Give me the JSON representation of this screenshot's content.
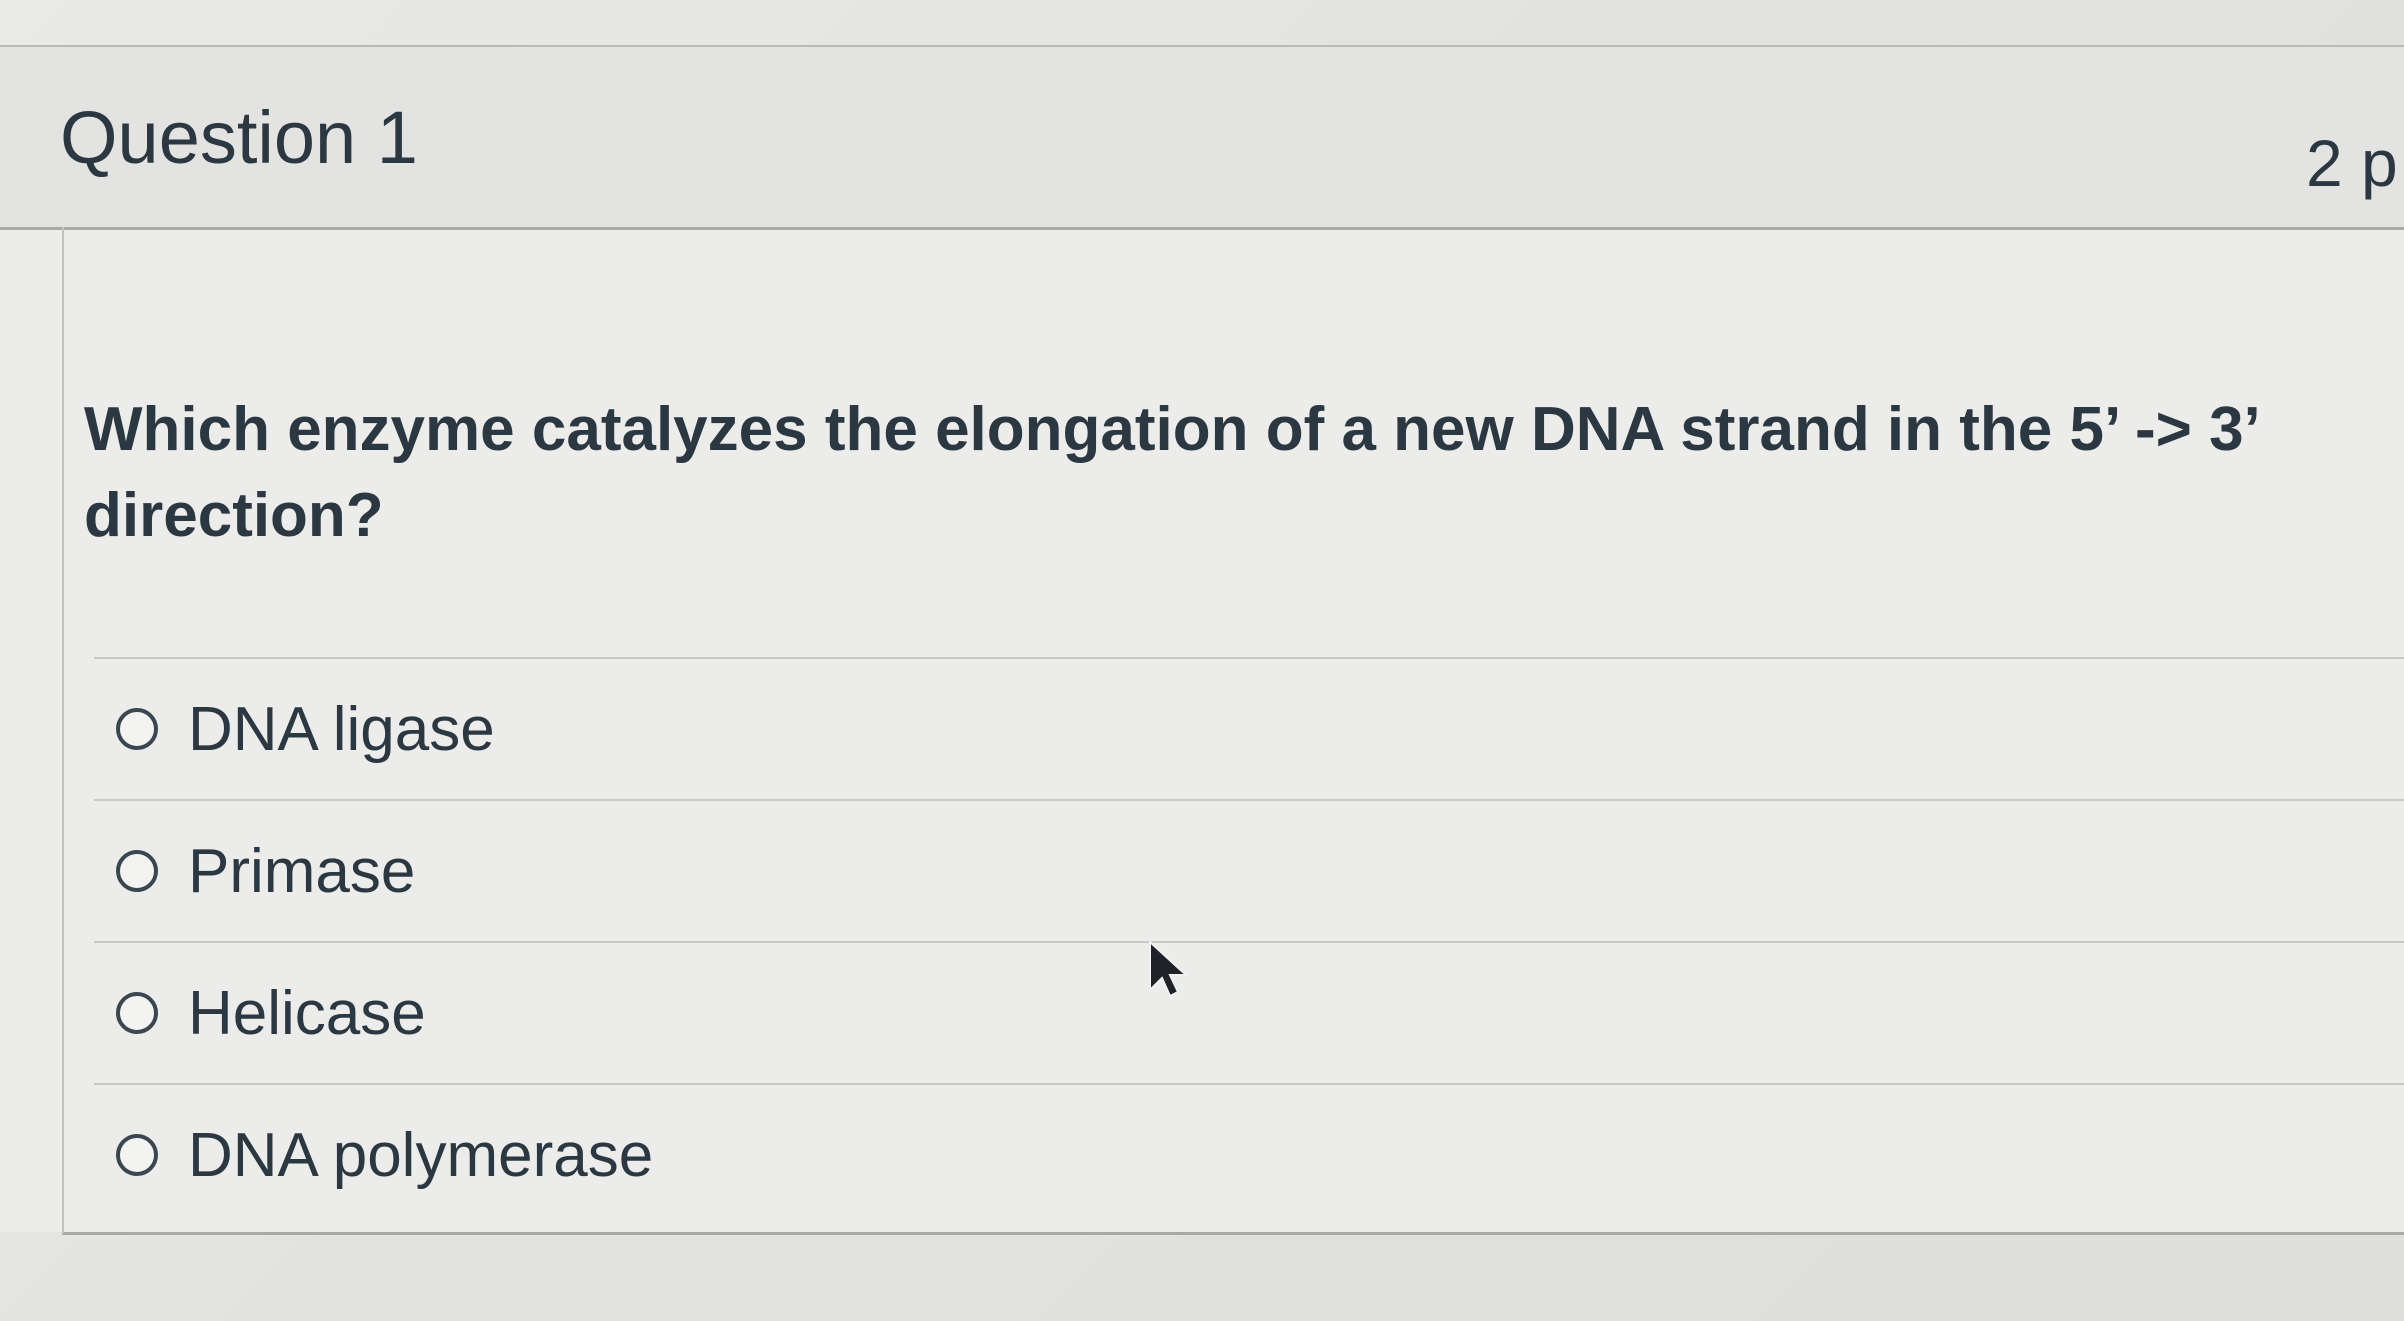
{
  "question": {
    "title": "Question 1",
    "points": "2 p",
    "text": "Which enzyme catalyzes the elongation of a new DNA strand in the 5’ -> 3’ direction?",
    "answers": [
      {
        "label": "DNA ligase"
      },
      {
        "label": "Primase"
      },
      {
        "label": "Helicase"
      },
      {
        "label": "DNA polymerase"
      }
    ]
  },
  "icons": {
    "radio": "radio-button-icon",
    "cursor": "mouse-pointer-icon"
  }
}
